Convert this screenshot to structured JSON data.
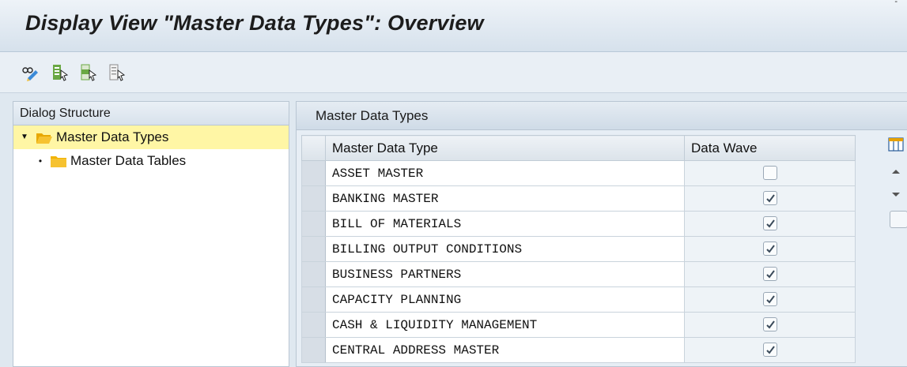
{
  "window": {
    "title": "Display View \"Master Data Types\": Overview"
  },
  "toolbar": {
    "buttons": [
      {
        "icon": "glasses-edit-icon"
      },
      {
        "icon": "select-all-icon"
      },
      {
        "icon": "select-block-icon"
      },
      {
        "icon": "deselect-all-icon"
      }
    ]
  },
  "dialog_structure": {
    "header": "Dialog Structure",
    "items": [
      {
        "label": "Master Data Types",
        "expanded": true,
        "selected": true,
        "icon": "open-folder-icon"
      },
      {
        "label": "Master Data Tables",
        "expanded": false,
        "selected": false,
        "icon": "folder-icon"
      }
    ]
  },
  "table": {
    "title": "Master Data Types",
    "columns": [
      "Master Data Type",
      "Data Wave"
    ],
    "rows": [
      {
        "type": "ASSET MASTER",
        "data_wave": false
      },
      {
        "type": "BANKING MASTER",
        "data_wave": true
      },
      {
        "type": "BILL OF MATERIALS",
        "data_wave": true
      },
      {
        "type": "BILLING OUTPUT CONDITIONS",
        "data_wave": true
      },
      {
        "type": "BUSINESS PARTNERS",
        "data_wave": true
      },
      {
        "type": "CAPACITY PLANNING",
        "data_wave": true
      },
      {
        "type": "CASH & LIQUIDITY MANAGEMENT",
        "data_wave": true
      },
      {
        "type": "CENTRAL ADDRESS MASTER",
        "data_wave": true
      }
    ]
  },
  "colors": {
    "selected_row": "#fff6a5",
    "folder": "#f4b400",
    "checkmark": "#3a4a5a"
  }
}
